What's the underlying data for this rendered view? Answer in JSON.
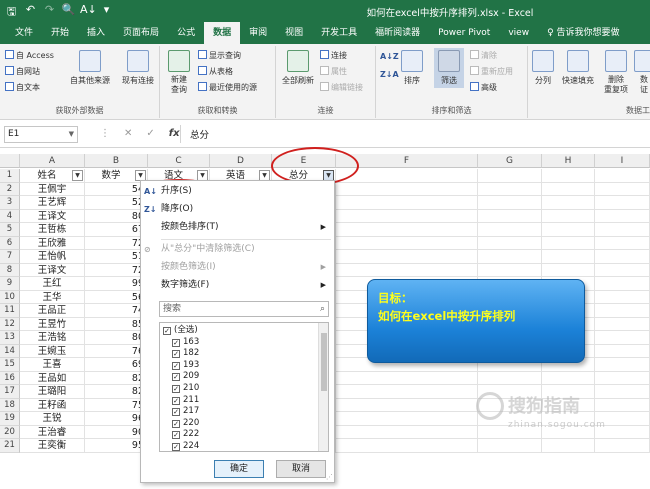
{
  "window": {
    "title": "如何在excel中按升序排列.xlsx - Excel"
  },
  "tabs": [
    "文件",
    "开始",
    "插入",
    "页面布局",
    "公式",
    "数据",
    "审阅",
    "视图",
    "开发工具",
    "福昕阅读器",
    "Power Pivot",
    "view",
    "♀ 告诉我你想要做"
  ],
  "ribbon": {
    "ext_data": {
      "access": "自 Access",
      "web": "自网站",
      "text": "自文本",
      "other": "自其他来源",
      "existing": "现有连接",
      "label": "获取外部数据"
    },
    "transform": {
      "new_query": "新建\n查询",
      "show_query": "显示查询",
      "from_table": "从表格",
      "recent": "最近使用的源",
      "label": "获取和转换"
    },
    "connections": {
      "refresh_all": "全部刷新",
      "conn": "连接",
      "props": "属性",
      "edit_links": "编辑链接",
      "label": "连接"
    },
    "sort_filter": {
      "sort": "排序",
      "filter": "筛选",
      "clear": "清除",
      "reapply": "重新应用",
      "advanced": "高级",
      "label": "排序和筛选"
    },
    "tools": {
      "split": "分列",
      "flash": "快速填充",
      "dedupe": "删除\n重复项",
      "validate": "数\n证",
      "label": "数据工"
    }
  },
  "formula_bar": {
    "name_box": "E1",
    "value": "总分"
  },
  "columns": [
    "A",
    "B",
    "C",
    "D",
    "E",
    "F",
    "G",
    "H",
    "I"
  ],
  "rows": [
    [
      "姓名",
      "数学",
      "语文",
      "英语",
      "总分"
    ],
    [
      "王佩宇",
      "54"
    ],
    [
      "王艺辉",
      "52"
    ],
    [
      "王译文",
      "80"
    ],
    [
      "王哲栋",
      "67"
    ],
    [
      "王欣雅",
      "72"
    ],
    [
      "王怡帆",
      "51"
    ],
    [
      "王译文",
      "72"
    ],
    [
      "王红",
      "99"
    ],
    [
      "王华",
      "56"
    ],
    [
      "王品正",
      "74"
    ],
    [
      "王昱竹",
      "85"
    ],
    [
      "王浩铭",
      "80"
    ],
    [
      "王婉玉",
      "76"
    ],
    [
      "王喜",
      "69"
    ],
    [
      "王品如",
      "82"
    ],
    [
      "王璐阳",
      "82"
    ],
    [
      "王籽函",
      "75"
    ],
    [
      "王锐",
      "96"
    ],
    [
      "王治睿",
      "90"
    ],
    [
      "王奕衡",
      "95"
    ]
  ],
  "dropdown": {
    "asc": "升序(S)",
    "desc": "降序(O)",
    "by_color": "按颜色排序(T)",
    "clear_filter": "从\"总分\"中清除筛选(C)",
    "filter_color": "按颜色筛选(I)",
    "num_filter": "数字筛选(F)",
    "search_placeholder": "搜索",
    "items": [
      "(全选)",
      "163",
      "182",
      "193",
      "209",
      "210",
      "211",
      "217",
      "220",
      "222",
      "224"
    ],
    "ok": "确定",
    "cancel": "取消"
  },
  "callout": {
    "line1": "目标：",
    "line2": "如何在excel中按升序排列"
  },
  "watermark": {
    "text": "搜狗指南",
    "url": "zhinan.sogou.com"
  }
}
